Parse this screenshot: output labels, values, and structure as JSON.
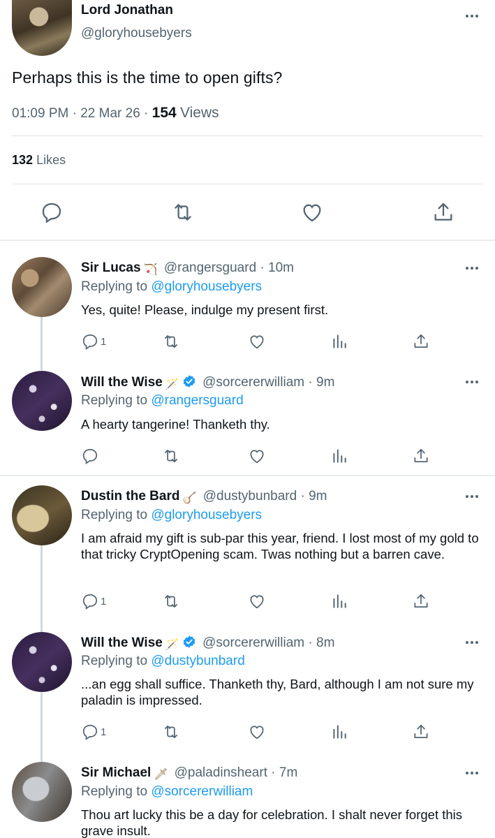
{
  "main_tweet": {
    "author_name": "Lord Jonathan",
    "author_handle": "@gloryhousebyers",
    "text": "Perhaps this is the time to open gifts?",
    "time": "01:09 PM",
    "date": "22 Mar 26",
    "views_count": "154",
    "views_label": "Views",
    "likes_count": "132",
    "likes_label": "Likes",
    "more_icon": "more-dots-icon",
    "actions": [
      "reply-icon",
      "retweet-icon",
      "like-icon",
      "share-icon"
    ]
  },
  "replies": [
    {
      "name": "Sir Lucas",
      "emoji": "bow-and-arrow-icon",
      "emoji_glyph": "🏹",
      "handle": "@rangersguard",
      "time": "10m",
      "replying_label": "Replying to",
      "replying_to": "@gloryhousebyers",
      "text": "Yes, quite! Please, indulge my present first.",
      "reply_count": "1"
    },
    {
      "name": "Will the Wise",
      "emoji": "magic-wand-icon",
      "emoji_glyph": "🪄",
      "verified": true,
      "handle": "@sorcererwilliam",
      "time": "9m",
      "replying_label": "Replying to",
      "replying_to": "@rangersguard",
      "text": "A hearty tangerine! Thanketh thy.",
      "reply_count": ""
    },
    {
      "name": "Dustin the Bard",
      "emoji": "banjo-icon",
      "emoji_glyph": "🪕",
      "handle": "@dustybunbard",
      "time": "9m",
      "replying_label": "Replying to",
      "replying_to": "@gloryhousebyers",
      "text": "I am afraid my gift is sub-par this year, friend. I lost most of my gold to that tricky CryptOpening scam. Twas nothing but a barren cave.",
      "reply_count": "1"
    },
    {
      "name": "Will the Wise",
      "emoji": "magic-wand-icon",
      "emoji_glyph": "🪄",
      "verified": true,
      "handle": "@sorcererwilliam",
      "time": "8m",
      "replying_label": "Replying to",
      "replying_to": "@dustybunbard",
      "text": "...an egg shall suffice. Thanketh thy, Bard, although I am not sure my paladin is impressed.",
      "reply_count": "1"
    },
    {
      "name": "Sir Michael",
      "emoji": "dagger-icon",
      "emoji_glyph": "🗡",
      "handle": "@paladinsheart",
      "time": "7m",
      "replying_label": "Replying to",
      "replying_to": "@sorcererwilliam",
      "text": "Thou art lucky this be a day for celebration. I shalt never forget this grave insult.",
      "reply_count": ""
    }
  ],
  "separator": "·",
  "colors": {
    "link": "#1d9bf0",
    "secondary": "#536471",
    "primary": "#0f1419",
    "verified": "#1d9bf0"
  }
}
